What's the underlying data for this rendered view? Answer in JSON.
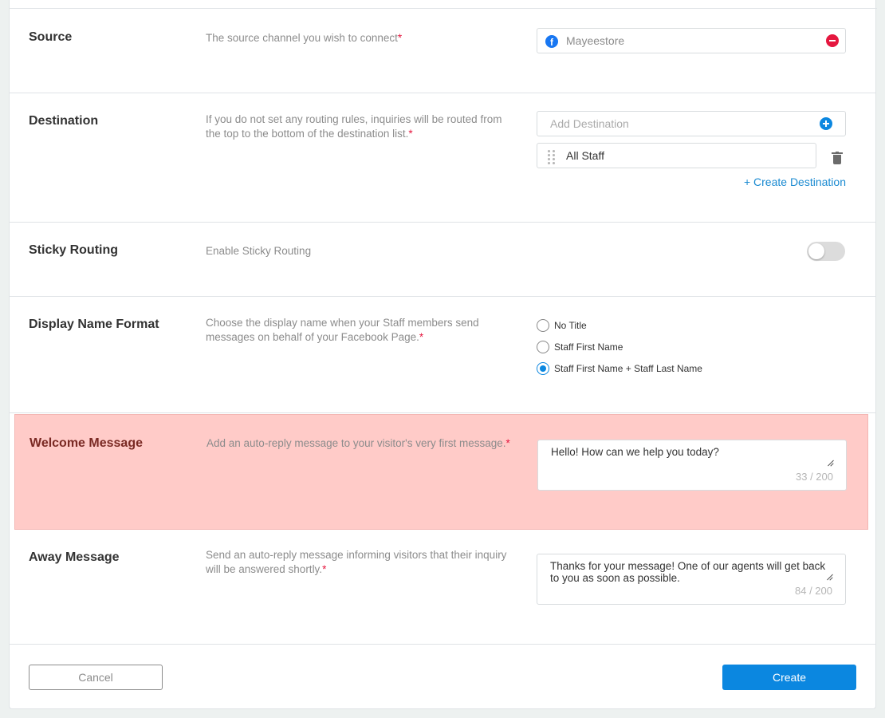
{
  "source": {
    "title": "Source",
    "description": "The source channel you wish to connect",
    "required_mark": "*",
    "channel": "Mayeestore",
    "channel_icon": "facebook-icon"
  },
  "destination": {
    "title": "Destination",
    "description": "If you do not set any routing rules, inquiries will be routed from the top to the bottom of the destination list.",
    "required_mark": "*",
    "add_placeholder": "Add Destination",
    "items": [
      {
        "label": "All Staff"
      }
    ],
    "create_link": "+ Create Destination"
  },
  "sticky_routing": {
    "title": "Sticky Routing",
    "description": "Enable Sticky Routing",
    "enabled": false
  },
  "display_name_format": {
    "title": "Display Name Format",
    "description": "Choose the display name when your Staff members send messages on behalf of your Facebook Page.",
    "required_mark": "*",
    "options": [
      {
        "label": "No Title",
        "checked": false
      },
      {
        "label": "Staff First Name",
        "checked": false
      },
      {
        "label": "Staff First Name + Staff Last Name",
        "checked": true
      }
    ]
  },
  "welcome_message": {
    "title": "Welcome Message",
    "description": "Add an auto-reply message to your visitor's very first message.",
    "required_mark": "*",
    "value": "Hello! How can we help you today?",
    "counter": "33 / 200"
  },
  "away_message": {
    "title": "Away Message",
    "description": "Send an auto-reply message informing visitors that their inquiry will be answered shortly.",
    "required_mark": "*",
    "value": "Thanks for your message! One of our agents will get back to you as soon as possible.",
    "counter": "84 / 200"
  },
  "footer": {
    "cancel_label": "Cancel",
    "create_label": "Create"
  },
  "colors": {
    "accent": "#0b87e0",
    "required": "#e5173f",
    "highlight": "#ffcbc8"
  }
}
